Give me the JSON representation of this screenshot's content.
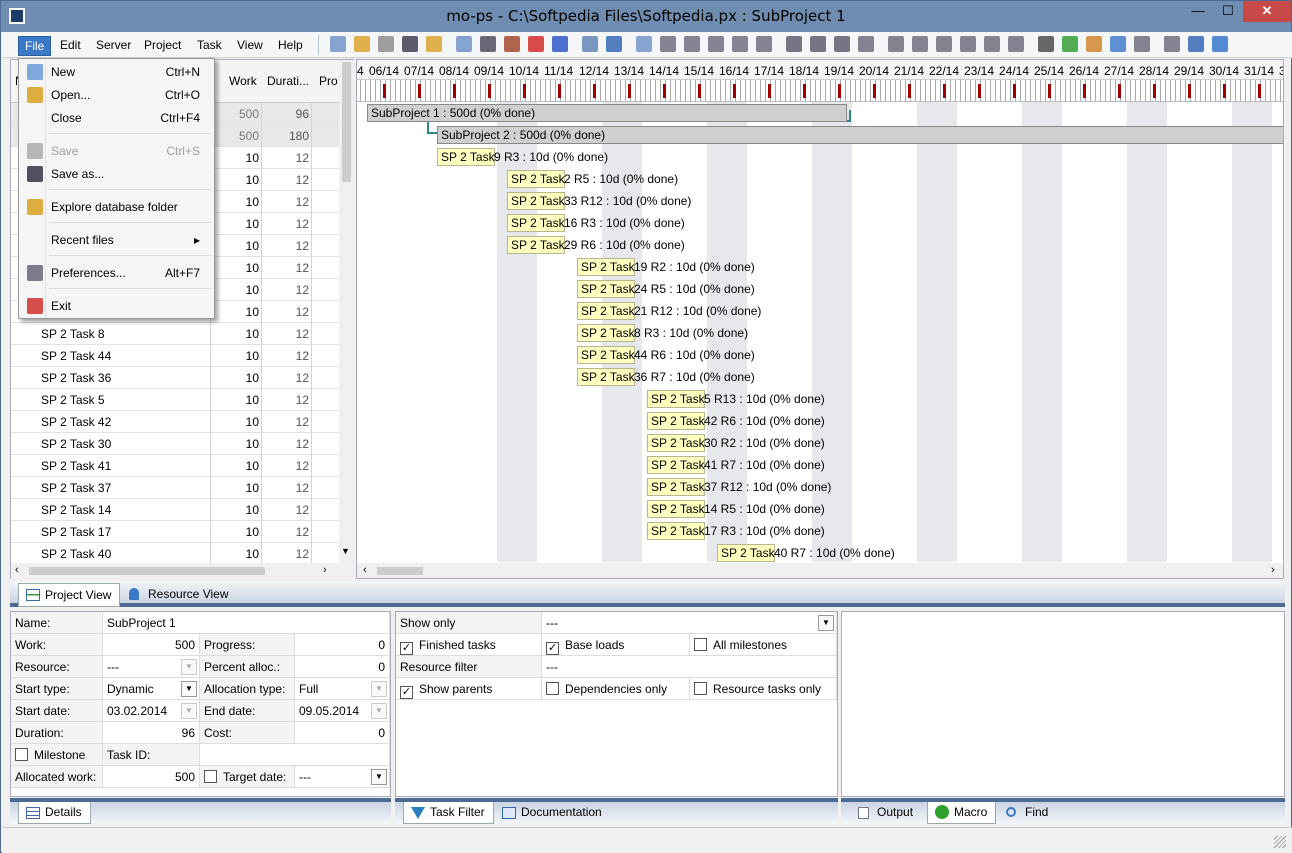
{
  "window": {
    "title": "mo-ps - C:\\Softpedia Files\\Softpedia.px : SubProject 1",
    "min": "—",
    "max": "☐",
    "close": "✕"
  },
  "menubar": [
    "File",
    "Edit",
    "Server",
    "Project",
    "Task",
    "View",
    "Help"
  ],
  "file_menu": [
    {
      "label": "New",
      "shortcut": "Ctrl+N",
      "icon": "new-document-icon",
      "enabled": true
    },
    {
      "label": "Open...",
      "shortcut": "Ctrl+O",
      "icon": "open-folder-icon",
      "enabled": true
    },
    {
      "label": "Close",
      "shortcut": "Ctrl+F4",
      "icon": "",
      "enabled": true
    },
    {
      "label": "Save",
      "shortcut": "Ctrl+S",
      "icon": "save-disk-icon",
      "enabled": false
    },
    {
      "label": "Save as...",
      "shortcut": "",
      "icon": "save-as-icon",
      "enabled": true
    },
    {
      "label": "Explore database folder",
      "shortcut": "",
      "icon": "database-folder-icon",
      "enabled": true
    },
    {
      "label": "Recent files",
      "shortcut": "▸",
      "icon": "",
      "enabled": true
    },
    {
      "label": "Preferences...",
      "shortcut": "Alt+F7",
      "icon": "preferences-tools-icon",
      "enabled": true
    },
    {
      "label": "Exit",
      "shortcut": "",
      "icon": "exit-icon",
      "enabled": true
    }
  ],
  "task_grid": {
    "headers": {
      "name": "N",
      "work": "Work",
      "duration": "Durati...",
      "progress": "Pro"
    },
    "rows": [
      {
        "name": "",
        "work": "500",
        "duration": "96"
      },
      {
        "name": "",
        "work": "500",
        "duration": "180"
      },
      {
        "name": "",
        "work": "10",
        "duration": "12"
      },
      {
        "name": "",
        "work": "10",
        "duration": "12"
      },
      {
        "name": "",
        "work": "10",
        "duration": "12"
      },
      {
        "name": "",
        "work": "10",
        "duration": "12"
      },
      {
        "name": "",
        "work": "10",
        "duration": "12"
      },
      {
        "name": "",
        "work": "10",
        "duration": "12"
      },
      {
        "name": "",
        "work": "10",
        "duration": "12"
      },
      {
        "name": "",
        "work": "10",
        "duration": "12"
      },
      {
        "name": "SP 2 Task 8",
        "work": "10",
        "duration": "12"
      },
      {
        "name": "SP 2 Task 44",
        "work": "10",
        "duration": "12"
      },
      {
        "name": "SP 2 Task 36",
        "work": "10",
        "duration": "12"
      },
      {
        "name": "SP 2 Task 5",
        "work": "10",
        "duration": "12"
      },
      {
        "name": "SP 2 Task 42",
        "work": "10",
        "duration": "12"
      },
      {
        "name": "SP 2 Task 30",
        "work": "10",
        "duration": "12"
      },
      {
        "name": "SP 2 Task 41",
        "work": "10",
        "duration": "12"
      },
      {
        "name": "SP 2 Task 37",
        "work": "10",
        "duration": "12"
      },
      {
        "name": "SP 2 Task 14",
        "work": "10",
        "duration": "12"
      },
      {
        "name": "SP 2 Task 17",
        "work": "10",
        "duration": "12"
      },
      {
        "name": "SP 2 Task 40",
        "work": "10",
        "duration": "12"
      }
    ]
  },
  "gantt": {
    "dates": [
      "4",
      "06/14",
      "07/14",
      "08/14",
      "09/14",
      "10/14",
      "11/14",
      "12/14",
      "13/14",
      "14/14",
      "15/14",
      "16/14",
      "17/14",
      "18/14",
      "19/14",
      "20/14",
      "21/14",
      "22/14",
      "23/14",
      "24/14",
      "25/14",
      "26/14",
      "27/14",
      "28/14",
      "29/14",
      "30/14",
      "31/14",
      "3"
    ],
    "summaries": [
      {
        "label": "SubProject 1  : 500d (0% done)"
      },
      {
        "label": "SubProject 2  : 500d (0% done)"
      }
    ],
    "bars": [
      {
        "label": "SP 2 Task",
        "tail": "9 R3 : 10d (0% done)",
        "col": 1
      },
      {
        "label": "SP 2 Task",
        "tail": "2 R5 : 10d (0% done)",
        "col": 2
      },
      {
        "label": "SP 2 Task",
        "tail": "33 R12 : 10d (0% done)",
        "col": 2
      },
      {
        "label": "SP 2 Task",
        "tail": "16 R3 : 10d (0% done)",
        "col": 2
      },
      {
        "label": "SP 2 Task",
        "tail": "29 R6 : 10d (0% done)",
        "col": 2
      },
      {
        "label": "SP 2 Task",
        "tail": "19 R2 : 10d (0% done)",
        "col": 3
      },
      {
        "label": "SP 2 Task",
        "tail": "24 R5 : 10d (0% done)",
        "col": 3
      },
      {
        "label": "SP 2 Task",
        "tail": "21 R12 : 10d (0% done)",
        "col": 3
      },
      {
        "label": "SP 2 Task",
        "tail": "8 R3 : 10d (0% done)",
        "col": 3
      },
      {
        "label": "SP 2 Task",
        "tail": "44 R6 : 10d (0% done)",
        "col": 3
      },
      {
        "label": "SP 2 Task",
        "tail": "36 R7 : 10d (0% done)",
        "col": 3
      },
      {
        "label": "SP 2 Task",
        "tail": "5 R13 : 10d (0% done)",
        "col": 4
      },
      {
        "label": "SP 2 Task",
        "tail": "42 R6 : 10d (0% done)",
        "col": 4
      },
      {
        "label": "SP 2 Task",
        "tail": "30 R2 : 10d (0% done)",
        "col": 4
      },
      {
        "label": "SP 2 Task",
        "tail": "41 R7 : 10d (0% done)",
        "col": 4
      },
      {
        "label": "SP 2 Task",
        "tail": "37 R12 : 10d (0% done)",
        "col": 4
      },
      {
        "label": "SP 2 Task",
        "tail": "14 R5 : 10d (0% done)",
        "col": 4
      },
      {
        "label": "SP 2 Task",
        "tail": "17 R3 : 10d (0% done)",
        "col": 4
      },
      {
        "label": "SP 2 Task",
        "tail": "40 R7 : 10d (0% done)",
        "col": 5
      }
    ]
  },
  "view_tabs": [
    {
      "label": "Project View",
      "icon": "project-view-icon"
    },
    {
      "label": "Resource View",
      "icon": "resource-person-icon"
    }
  ],
  "details": {
    "name_label": "Name:",
    "name_value": "SubProject 1",
    "work_label": "Work:",
    "work_value": "500",
    "progress_label": "Progress:",
    "progress_value": "0",
    "resource_label": "Resource:",
    "resource_value": "---",
    "percent_label": "Percent alloc.:",
    "percent_value": "0",
    "start_type_label": "Start type:",
    "start_type_value": "Dynamic",
    "alloc_type_label": "Allocation type:",
    "alloc_type_value": "Full",
    "start_date_label": "Start date:",
    "start_date_value": "03.02.2014",
    "end_date_label": "End date:",
    "end_date_value": "09.05.2014",
    "duration_label": "Duration:",
    "duration_value": "96",
    "cost_label": "Cost:",
    "cost_value": "0",
    "milestone_label": "Milestone",
    "task_id_label": "Task ID:",
    "task_id_value": "",
    "alloc_work_label": "Allocated work:",
    "alloc_work_value": "500",
    "target_date_label": "Target date:",
    "target_date_value": "---"
  },
  "filter": {
    "show_only_label": "Show only",
    "show_only_value": "---",
    "finished": "Finished tasks",
    "base_loads": "Base loads",
    "all_milestones": "All milestones",
    "resource_filter_label": "Resource filter",
    "resource_filter_value": "---",
    "show_parents": "Show parents",
    "deps_only": "Dependencies only",
    "res_tasks_only": "Resource tasks only"
  },
  "bottom_tabs": {
    "left": [
      {
        "label": "Details"
      }
    ],
    "middle": [
      {
        "label": "Task Filter"
      },
      {
        "label": "Documentation"
      }
    ],
    "right": [
      {
        "label": "Output"
      },
      {
        "label": "Macro"
      },
      {
        "label": "Find"
      }
    ]
  },
  "colors": {
    "accent": "#3a78c8",
    "bar": "#ffffc0",
    "tick": "#a00000",
    "close": "#c74a48"
  }
}
